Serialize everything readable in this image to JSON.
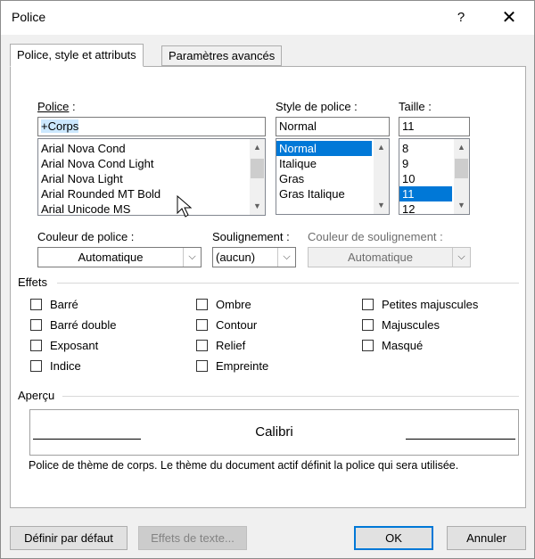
{
  "window": {
    "title": "Police",
    "help": "?",
    "close": "✕"
  },
  "tabs": [
    {
      "label": "Police, style et attributs",
      "active": true
    },
    {
      "label": "Paramètres avancés",
      "active": false
    }
  ],
  "font": {
    "label": "Police",
    "label_colon": " :",
    "value": "+Corps",
    "items": [
      "Arial Nova Cond",
      "Arial Nova Cond Light",
      "Arial Nova Light",
      "Arial Rounded MT Bold",
      "Arial Unicode MS"
    ]
  },
  "style": {
    "label": "Style de police :",
    "value": "Normal",
    "items": [
      "Normal",
      "Italique",
      "Gras",
      "Gras Italique"
    ],
    "selected": "Normal"
  },
  "size": {
    "label": "Taille :",
    "value": "11",
    "items": [
      "8",
      "9",
      "10",
      "11",
      "12"
    ],
    "selected": "11"
  },
  "font_color": {
    "label": "Couleur de police :",
    "value": "Automatique"
  },
  "underline": {
    "label": "Soulignement :",
    "value": "(aucun)"
  },
  "underline_color": {
    "label": "Couleur de soulignement :",
    "value": "Automatique"
  },
  "effects": {
    "title": "Effets",
    "col1": [
      "Barré",
      "Barré double",
      "Exposant",
      "Indice"
    ],
    "col2": [
      "Ombre",
      "Contour",
      "Relief",
      "Empreinte"
    ],
    "col3": [
      "Petites majuscules",
      "Majuscules",
      "Masqué"
    ]
  },
  "preview": {
    "title": "Aperçu",
    "sample": "Calibri",
    "description": "Police de thème de corps. Le thème du document actif définit la police qui sera utilisée."
  },
  "buttons": {
    "default": "Définir par défaut",
    "text_effects": "Effets de texte...",
    "ok": "OK",
    "cancel": "Annuler"
  }
}
